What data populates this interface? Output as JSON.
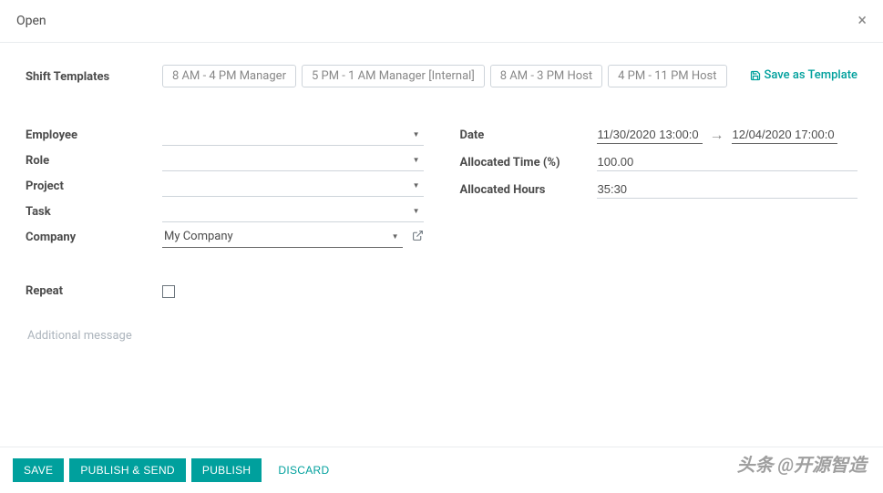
{
  "header": {
    "title": "Open"
  },
  "templates": {
    "label": "Shift Templates",
    "items": [
      "8 AM - 4 PM Manager",
      "5 PM - 1 AM Manager [Internal]",
      "8 AM - 3 PM Host",
      "4 PM - 11 PM Host"
    ],
    "save_label": "Save as Template"
  },
  "left_fields": {
    "employee": {
      "label": "Employee",
      "value": ""
    },
    "role": {
      "label": "Role",
      "value": ""
    },
    "project": {
      "label": "Project",
      "value": ""
    },
    "task": {
      "label": "Task",
      "value": ""
    },
    "company": {
      "label": "Company",
      "value": "My Company"
    }
  },
  "right_fields": {
    "date": {
      "label": "Date",
      "from": "11/30/2020 13:00:0",
      "to": "12/04/2020 17:00:0"
    },
    "allocated_pct": {
      "label": "Allocated Time (%)",
      "value": "100.00"
    },
    "allocated_hours": {
      "label": "Allocated Hours",
      "value": "35:30"
    }
  },
  "repeat": {
    "label": "Repeat",
    "checked": false
  },
  "additional_message": {
    "placeholder": "Additional message"
  },
  "footer": {
    "save": "SAVE",
    "publish_send": "PUBLISH & SEND",
    "publish": "PUBLISH",
    "discard": "DISCARD"
  },
  "watermark": "头条 @开源智造"
}
